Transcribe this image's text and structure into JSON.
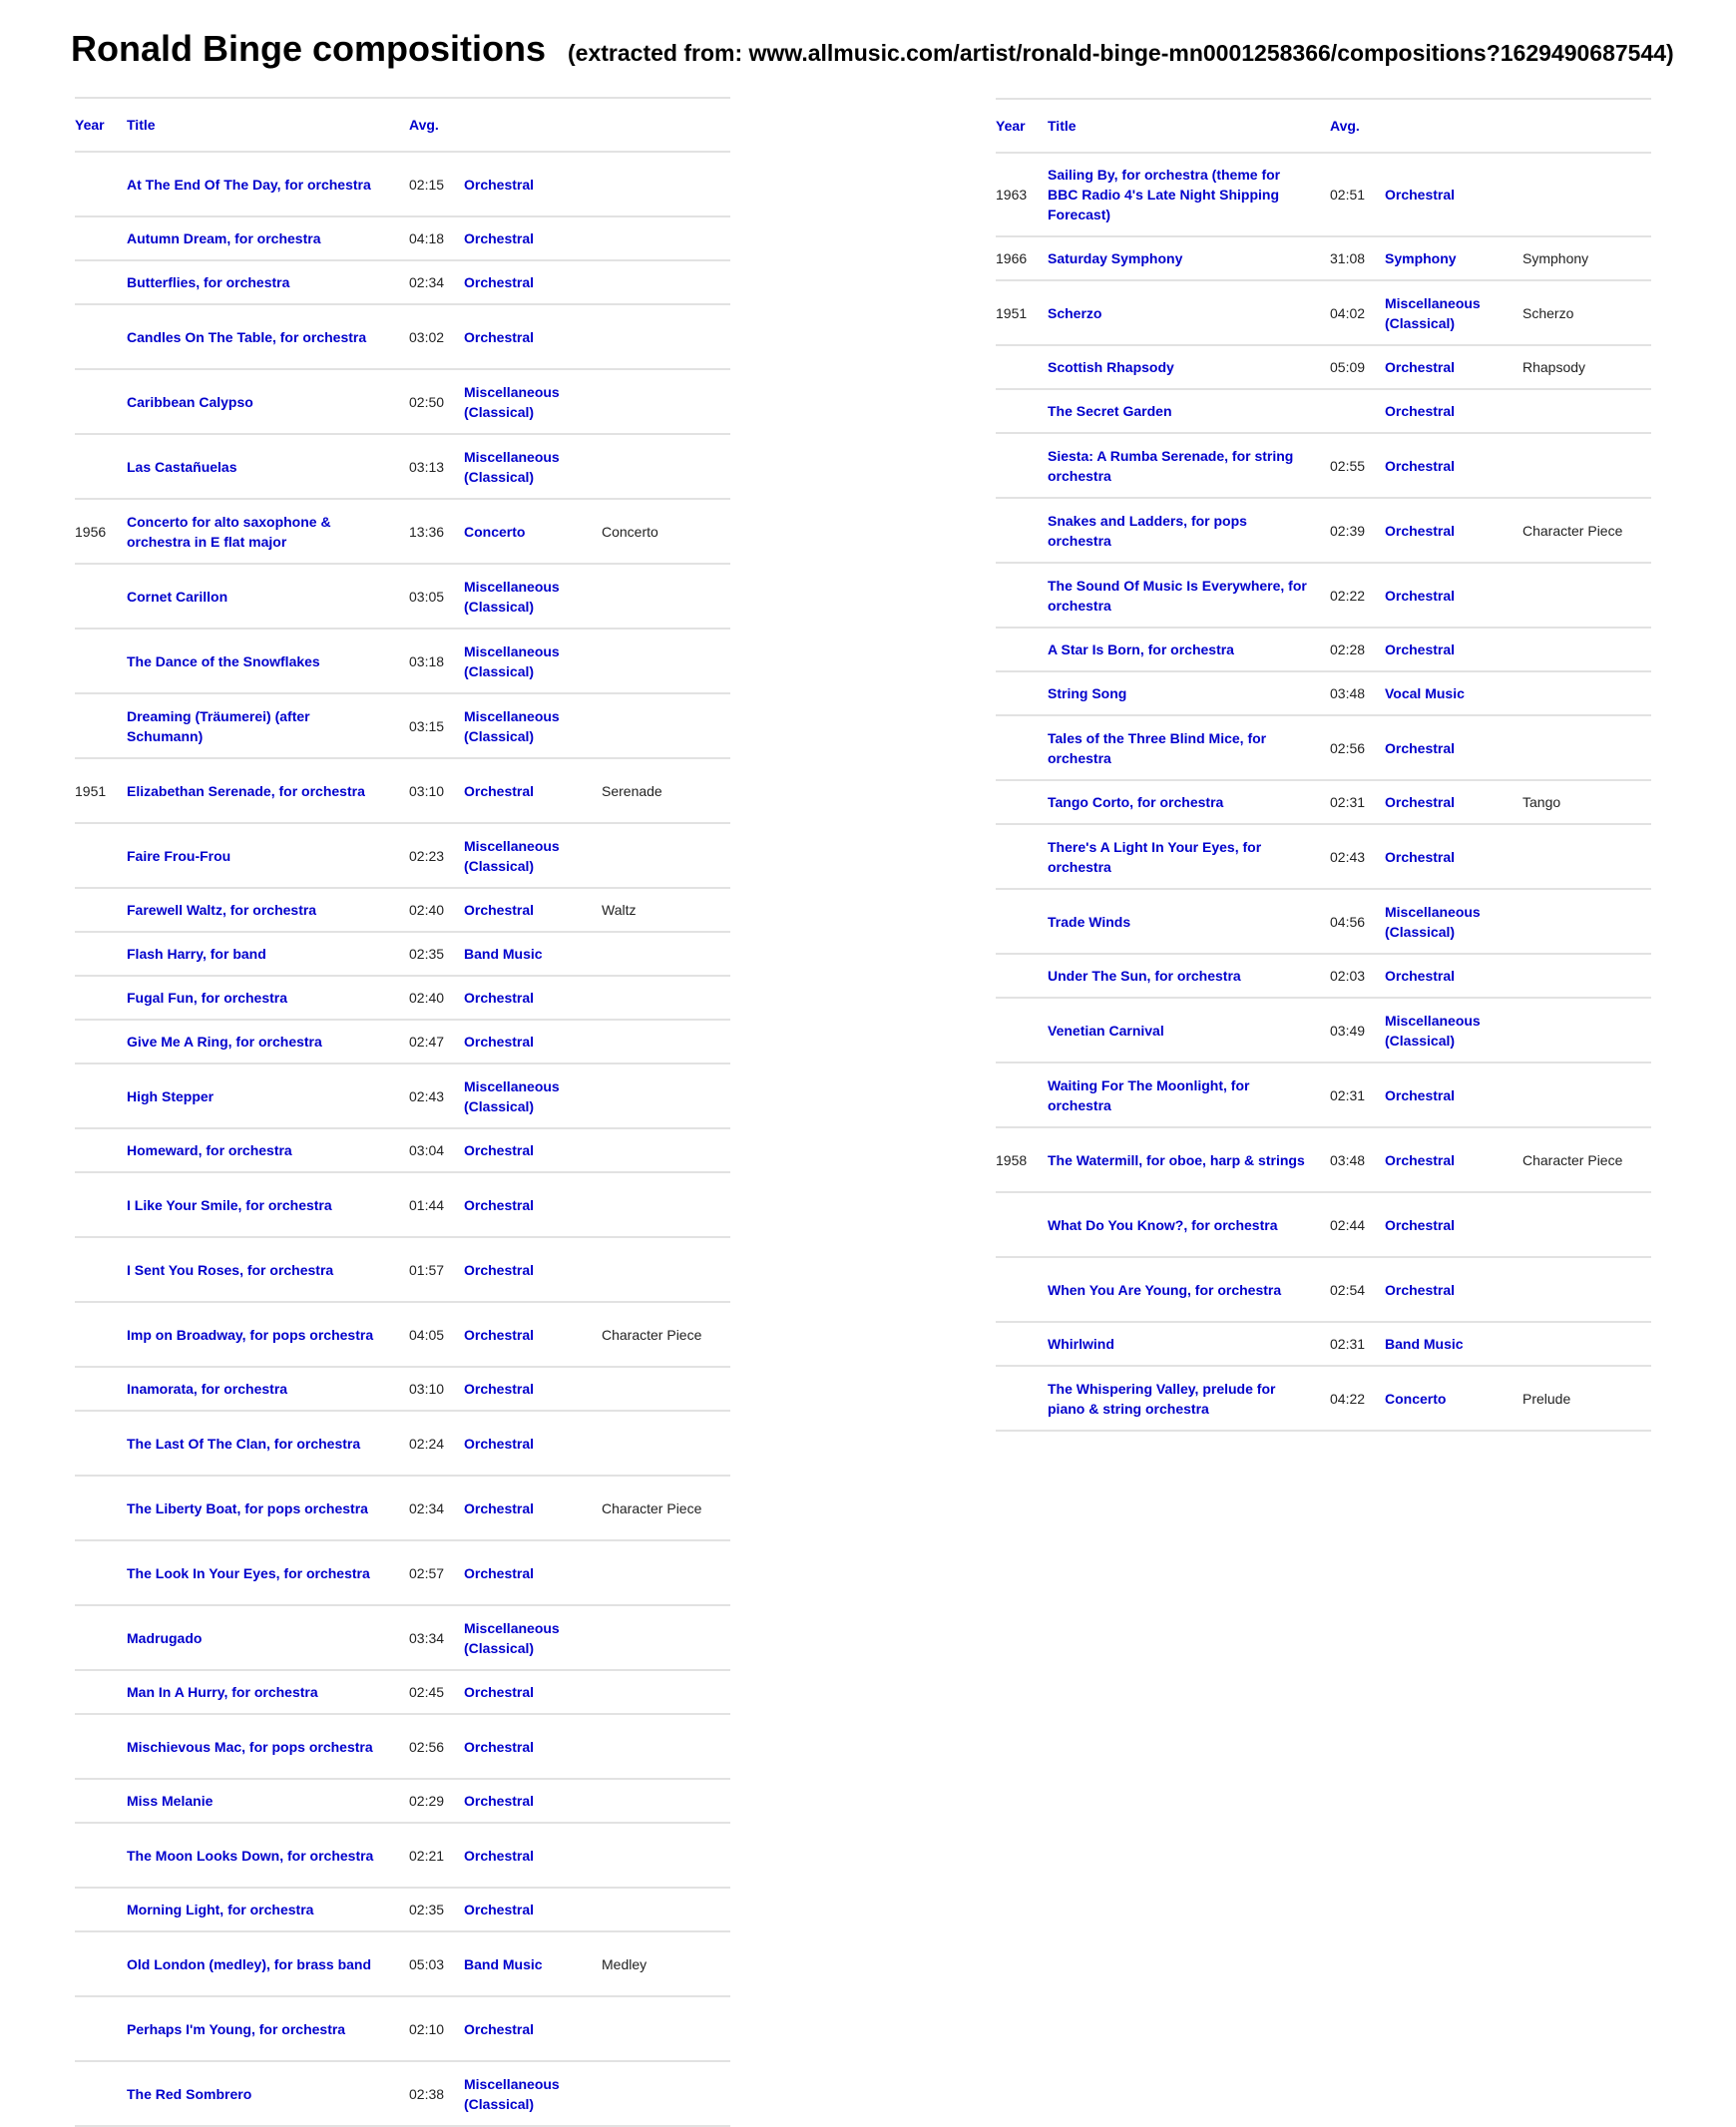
{
  "page": {
    "title": "Ronald Binge compositions",
    "subtitle": "(extracted from: www.allmusic.com/artist/ronald-binge-mn0001258366/compositions?1629490687544)"
  },
  "colors": {
    "link": "#0000cc",
    "divider": "#e2e2e2",
    "text": "#1a1a1a"
  },
  "columns": {
    "year": "Year",
    "title": "Title",
    "avg": "Avg.",
    "genre": "",
    "style": ""
  },
  "tables": [
    {
      "rows": [
        {
          "year": "",
          "title": "At The End Of The Day, for orchestra",
          "avg": "02:15",
          "genre": "Orchestral",
          "style": ""
        },
        {
          "year": "",
          "title": "Autumn Dream, for orchestra",
          "avg": "04:18",
          "genre": "Orchestral",
          "style": ""
        },
        {
          "year": "",
          "title": "Butterflies, for orchestra",
          "avg": "02:34",
          "genre": "Orchestral",
          "style": ""
        },
        {
          "year": "",
          "title": "Candles On The Table, for orchestra",
          "avg": "03:02",
          "genre": "Orchestral",
          "style": ""
        },
        {
          "year": "",
          "title": "Caribbean Calypso",
          "avg": "02:50",
          "genre": "Miscellaneous (Classical)",
          "style": ""
        },
        {
          "year": "",
          "title": "Las Castañuelas",
          "avg": "03:13",
          "genre": "Miscellaneous (Classical)",
          "style": ""
        },
        {
          "year": "1956",
          "title": "Concerto for alto saxophone & orchestra in E flat major",
          "avg": "13:36",
          "genre": "Concerto",
          "style": "Concerto"
        },
        {
          "year": "",
          "title": "Cornet Carillon",
          "avg": "03:05",
          "genre": "Miscellaneous (Classical)",
          "style": ""
        },
        {
          "year": "",
          "title": "The Dance of the Snowflakes",
          "avg": "03:18",
          "genre": "Miscellaneous (Classical)",
          "style": ""
        },
        {
          "year": "",
          "title": "Dreaming (Träumerei) (after Schumann)",
          "avg": "03:15",
          "genre": "Miscellaneous (Classical)",
          "style": ""
        },
        {
          "year": "1951",
          "title": "Elizabethan Serenade, for orchestra",
          "avg": "03:10",
          "genre": "Orchestral",
          "style": "Serenade"
        },
        {
          "year": "",
          "title": "Faire Frou-Frou",
          "avg": "02:23",
          "genre": "Miscellaneous (Classical)",
          "style": ""
        },
        {
          "year": "",
          "title": "Farewell Waltz, for orchestra",
          "avg": "02:40",
          "genre": "Orchestral",
          "style": "Waltz"
        },
        {
          "year": "",
          "title": "Flash Harry, for band",
          "avg": "02:35",
          "genre": "Band Music",
          "style": ""
        },
        {
          "year": "",
          "title": "Fugal Fun, for orchestra",
          "avg": "02:40",
          "genre": "Orchestral",
          "style": ""
        },
        {
          "year": "",
          "title": "Give Me A Ring, for orchestra",
          "avg": "02:47",
          "genre": "Orchestral",
          "style": ""
        },
        {
          "year": "",
          "title": "High Stepper",
          "avg": "02:43",
          "genre": "Miscellaneous (Classical)",
          "style": ""
        },
        {
          "year": "",
          "title": "Homeward, for orchestra",
          "avg": "03:04",
          "genre": "Orchestral",
          "style": ""
        },
        {
          "year": "",
          "title": "I Like Your Smile, for orchestra",
          "avg": "01:44",
          "genre": "Orchestral",
          "style": ""
        },
        {
          "year": "",
          "title": "I Sent You Roses, for orchestra",
          "avg": "01:57",
          "genre": "Orchestral",
          "style": ""
        },
        {
          "year": "",
          "title": "Imp on Broadway, for pops orchestra",
          "avg": "04:05",
          "genre": "Orchestral",
          "style": "Character Piece"
        },
        {
          "year": "",
          "title": "Inamorata, for orchestra",
          "avg": "03:10",
          "genre": "Orchestral",
          "style": ""
        },
        {
          "year": "",
          "title": "The Last Of The Clan, for orchestra",
          "avg": "02:24",
          "genre": "Orchestral",
          "style": ""
        },
        {
          "year": "",
          "title": "The Liberty Boat, for pops orchestra",
          "avg": "02:34",
          "genre": "Orchestral",
          "style": "Character Piece"
        },
        {
          "year": "",
          "title": "The Look In Your Eyes, for orchestra",
          "avg": "02:57",
          "genre": "Orchestral",
          "style": ""
        },
        {
          "year": "",
          "title": "Madrugado",
          "avg": "03:34",
          "genre": "Miscellaneous (Classical)",
          "style": ""
        },
        {
          "year": "",
          "title": "Man In A Hurry, for orchestra",
          "avg": "02:45",
          "genre": "Orchestral",
          "style": ""
        },
        {
          "year": "",
          "title": "Mischievous Mac, for pops orchestra",
          "avg": "02:56",
          "genre": "Orchestral",
          "style": ""
        },
        {
          "year": "",
          "title": "Miss Melanie",
          "avg": "02:29",
          "genre": "Orchestral",
          "style": ""
        },
        {
          "year": "",
          "title": "The Moon Looks Down, for orchestra",
          "avg": "02:21",
          "genre": "Orchestral",
          "style": ""
        },
        {
          "year": "",
          "title": "Morning Light, for orchestra",
          "avg": "02:35",
          "genre": "Orchestral",
          "style": ""
        },
        {
          "year": "",
          "title": "Old London (medley), for brass band",
          "avg": "05:03",
          "genre": "Band Music",
          "style": "Medley"
        },
        {
          "year": "",
          "title": "Perhaps I'm Young, for orchestra",
          "avg": "02:10",
          "genre": "Orchestral",
          "style": ""
        },
        {
          "year": "",
          "title": "The Red Sombrero",
          "avg": "02:38",
          "genre": "Miscellaneous (Classical)",
          "style": ""
        }
      ]
    },
    {
      "rows": [
        {
          "year": "1963",
          "title": "Sailing By, for orchestra (theme for BBC Radio 4's Late Night Shipping Forecast)",
          "avg": "02:51",
          "genre": "Orchestral",
          "style": ""
        },
        {
          "year": "1966",
          "title": "Saturday Symphony",
          "avg": "31:08",
          "genre": "Symphony",
          "style": "Symphony"
        },
        {
          "year": "1951",
          "title": "Scherzo",
          "avg": "04:02",
          "genre": "Miscellaneous (Classical)",
          "style": "Scherzo"
        },
        {
          "year": "",
          "title": "Scottish Rhapsody",
          "avg": "05:09",
          "genre": "Orchestral",
          "style": "Rhapsody"
        },
        {
          "year": "",
          "title": "The Secret Garden",
          "avg": "",
          "genre": "Orchestral",
          "style": ""
        },
        {
          "year": "",
          "title": "Siesta: A Rumba Serenade, for string orchestra",
          "avg": "02:55",
          "genre": "Orchestral",
          "style": ""
        },
        {
          "year": "",
          "title": "Snakes and Ladders, for pops orchestra",
          "avg": "02:39",
          "genre": "Orchestral",
          "style": "Character Piece"
        },
        {
          "year": "",
          "title": "The Sound Of Music Is Everywhere, for orchestra",
          "avg": "02:22",
          "genre": "Orchestral",
          "style": ""
        },
        {
          "year": "",
          "title": "A Star Is Born, for orchestra",
          "avg": "02:28",
          "genre": "Orchestral",
          "style": ""
        },
        {
          "year": "",
          "title": "String Song",
          "avg": "03:48",
          "genre": "Vocal Music",
          "style": ""
        },
        {
          "year": "",
          "title": "Tales of the Three Blind Mice, for orchestra",
          "avg": "02:56",
          "genre": "Orchestral",
          "style": ""
        },
        {
          "year": "",
          "title": "Tango Corto, for orchestra",
          "avg": "02:31",
          "genre": "Orchestral",
          "style": "Tango"
        },
        {
          "year": "",
          "title": "There's A Light In Your Eyes, for orchestra",
          "avg": "02:43",
          "genre": "Orchestral",
          "style": ""
        },
        {
          "year": "",
          "title": "Trade Winds",
          "avg": "04:56",
          "genre": "Miscellaneous (Classical)",
          "style": ""
        },
        {
          "year": "",
          "title": "Under The Sun, for orchestra",
          "avg": "02:03",
          "genre": "Orchestral",
          "style": ""
        },
        {
          "year": "",
          "title": "Venetian Carnival",
          "avg": "03:49",
          "genre": "Miscellaneous (Classical)",
          "style": ""
        },
        {
          "year": "",
          "title": "Waiting For The Moonlight, for orchestra",
          "avg": "02:31",
          "genre": "Orchestral",
          "style": ""
        },
        {
          "year": "1958",
          "title": "The Watermill, for oboe, harp & strings",
          "avg": "03:48",
          "genre": "Orchestral",
          "style": "Character Piece"
        },
        {
          "year": "",
          "title": "What Do You Know?, for orchestra",
          "avg": "02:44",
          "genre": "Orchestral",
          "style": ""
        },
        {
          "year": "",
          "title": "When You Are Young, for orchestra",
          "avg": "02:54",
          "genre": "Orchestral",
          "style": ""
        },
        {
          "year": "",
          "title": "Whirlwind",
          "avg": "02:31",
          "genre": "Band Music",
          "style": ""
        },
        {
          "year": "",
          "title": "The Whispering Valley, prelude for piano & string orchestra",
          "avg": "04:22",
          "genre": "Concerto",
          "style": "Prelude"
        }
      ]
    }
  ]
}
